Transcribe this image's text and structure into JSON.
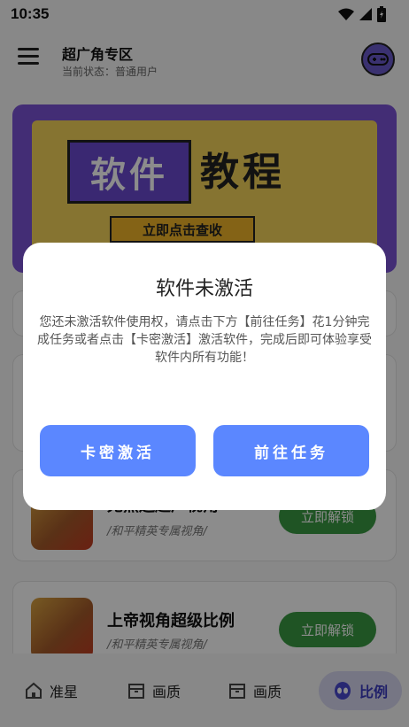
{
  "status_bar": {
    "time": "10:35"
  },
  "header": {
    "title": "超广角专区",
    "subtitle": "当前状态：普通用户"
  },
  "banner": {
    "word_a": "软件",
    "word_b": "教程",
    "button": "立即点击查收"
  },
  "cards": [
    {
      "title": "无黑边超广视角",
      "subtitle": "/和平精英专属视角/",
      "button": "立即解锁"
    },
    {
      "title": "上帝视角超级比例",
      "subtitle": "/和平精英专属视角/",
      "button": "立即解锁"
    }
  ],
  "bottom_nav": {
    "items": [
      {
        "label": "准星",
        "icon": "home-icon"
      },
      {
        "label": "画质",
        "icon": "box-icon"
      },
      {
        "label": "画质",
        "icon": "box-icon"
      },
      {
        "label": "比例",
        "icon": "alien-icon",
        "active": true
      }
    ]
  },
  "dialog": {
    "title": "软件未激活",
    "message": "您还未激活软件使用权，请点击下方【前往任务】花1分钟完成任务或者点击【卡密激活】激活软件，完成后即可体验享受软件内所有功能！",
    "btn_left": "卡密激活",
    "btn_right": "前往任务"
  },
  "colors": {
    "accent": "#5b87ff",
    "unlock": "#3a9a43",
    "banner": "#7b52d6"
  }
}
